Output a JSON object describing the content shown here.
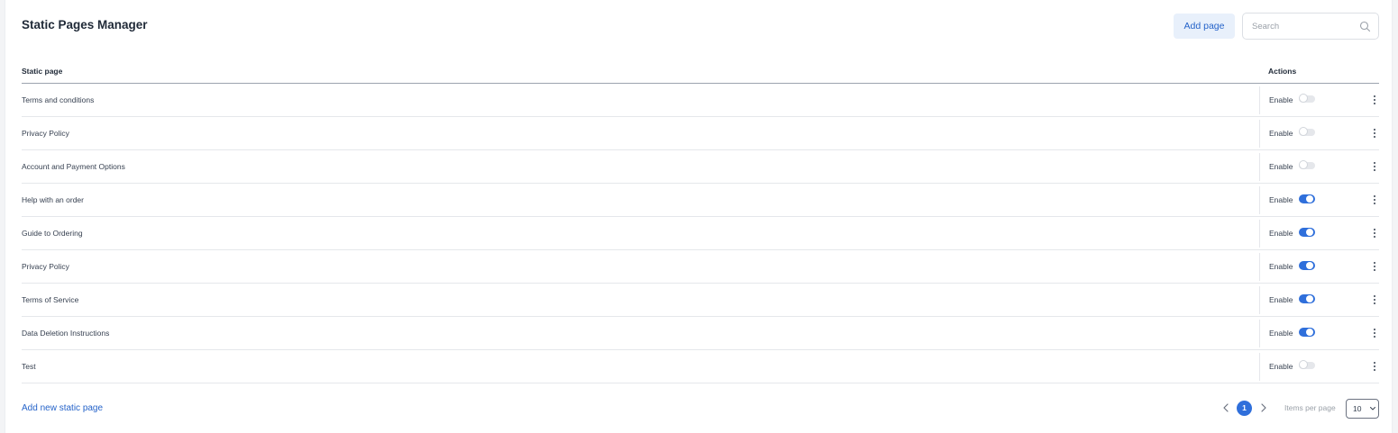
{
  "header": {
    "title": "Static Pages Manager",
    "add_page_label": "Add page",
    "search_placeholder": "Search",
    "search_value": ""
  },
  "table": {
    "columns": [
      "Static page",
      "Actions"
    ],
    "rows": [
      {
        "name": "Terms and conditions",
        "status_label": "Enable",
        "enabled": false
      },
      {
        "name": "Privacy Policy",
        "status_label": "Enable",
        "enabled": false
      },
      {
        "name": "Account and Payment Options",
        "status_label": "Enable",
        "enabled": false
      },
      {
        "name": "Help with an order",
        "status_label": "Enable",
        "enabled": true
      },
      {
        "name": "Guide to Ordering",
        "status_label": "Enable",
        "enabled": true
      },
      {
        "name": "Privacy Policy",
        "status_label": "Enable",
        "enabled": true
      },
      {
        "name": "Terms of Service",
        "status_label": "Enable",
        "enabled": true
      },
      {
        "name": "Data Deletion Instructions",
        "status_label": "Enable",
        "enabled": true
      },
      {
        "name": "Test",
        "status_label": "Enable",
        "enabled": false
      }
    ]
  },
  "footer": {
    "add_link_label": "Add new static page",
    "current_page": "1",
    "items_per_page_label": "Items per page",
    "items_per_page_value": "10"
  },
  "colors": {
    "accent": "#2f6fdb",
    "link": "#2563c9",
    "button_bg": "#e8f0fb"
  },
  "icons": [
    "search-icon",
    "kebab-menu-icon",
    "chevron-left-icon",
    "chevron-right-icon",
    "chevron-down-icon"
  ]
}
